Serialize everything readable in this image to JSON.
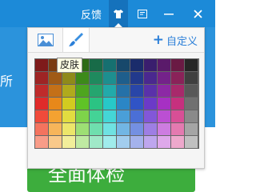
{
  "titlebar": {
    "feedback_label": "反馈",
    "skin_glyph": "👕",
    "menu_glyph": "☰",
    "minimize_glyph": "—",
    "close_glyph": "✕"
  },
  "background": {
    "side_text": "所",
    "button_label": "全面体检"
  },
  "skin_panel": {
    "custom_label": "自定义",
    "custom_plus": "+",
    "tooltip": "皮肤",
    "accent_color": "#2b7fd8",
    "palette": [
      [
        "#7e1a1a",
        "#7a3c0f",
        "#6e6a14",
        "#2e6b14",
        "#186b48",
        "#167070",
        "#17486b",
        "#1a2c6b",
        "#3a1e6e",
        "#5a1a6a",
        "#6a1a44",
        "#262626"
      ],
      [
        "#9e2424",
        "#a05a16",
        "#8f8a1a",
        "#3d8a1a",
        "#1f8a5e",
        "#1d8f8f",
        "#1e5e8c",
        "#22398c",
        "#4a288f",
        "#74228a",
        "#8a2259",
        "#3f3f3f"
      ],
      [
        "#bf2b2b",
        "#c47018",
        "#b0aa1d",
        "#4ea51f",
        "#25a56f",
        "#22aaaa",
        "#2571a8",
        "#2946a8",
        "#5a31aa",
        "#8c29a5",
        "#a8296b",
        "#585858"
      ],
      [
        "#e02a2a",
        "#e8881a",
        "#d2cb20",
        "#5fc326",
        "#2bc383",
        "#27c8c8",
        "#2b86c6",
        "#3054c6",
        "#6b3ac8",
        "#a630c3",
        "#c6307e",
        "#707070"
      ],
      [
        "#f04a3a",
        "#f4a231",
        "#e2dc40",
        "#7ed34a",
        "#44d396",
        "#44d6d6",
        "#4a9fd8",
        "#4b6fd6",
        "#8257d8",
        "#bb4fd3",
        "#d84f96",
        "#8a8a8a"
      ],
      [
        "#f4735e",
        "#f7b55a",
        "#ece66a",
        "#9ddf74",
        "#6fdfae",
        "#6fe2e2",
        "#72b6e4",
        "#7490e2",
        "#9e7ee4",
        "#cd7ce0",
        "#e47ab0",
        "#a5a5a5"
      ],
      [
        "#f89c88",
        "#f9c98a",
        "#f2ee9a",
        "#bfeaa2",
        "#a0e9c8",
        "#a0ecec",
        "#a2cdee",
        "#a4b2ec",
        "#bea6ee",
        "#dea8ea",
        "#eea8cc",
        "#c0c0c0"
      ]
    ]
  }
}
